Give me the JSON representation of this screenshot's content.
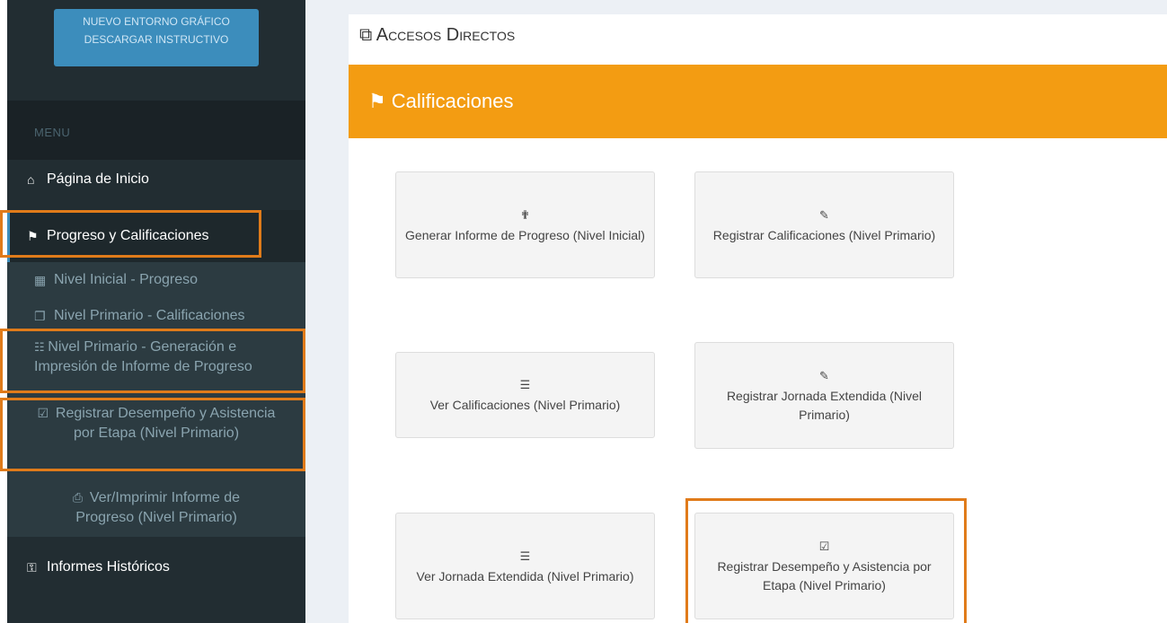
{
  "sidebar": {
    "banner": {
      "line1": "NUEVO ENTORNO GRÁFICO",
      "line2": "DESCARGAR INSTRUCTIVO"
    },
    "menu_header": "MENU",
    "home": "Página de Inicio",
    "progreso": "Progreso y Calificaciones",
    "sub": {
      "inicial": "Nivel Inicial - Progreso",
      "primario_calif": "Nivel Primario - Calificaciones",
      "generacion": "Nivel Primario - Generación e Impresión de Informe de Progreso",
      "registrar": "Registrar Desempeño y Asistencia por Etapa (Nivel Primario)",
      "imprimir": "Ver/Imprimir Informe de Progreso (Nivel Primario)"
    },
    "historicos": "Informes Históricos"
  },
  "content": {
    "title": "Accesos Directos",
    "section": "Calificaciones",
    "tiles": [
      {
        "icon": "child-icon",
        "label": "Generar Informe de Progreso (Nivel Inicial)"
      },
      {
        "icon": "edit-icon",
        "label": "Registrar Calificaciones (Nivel Primario)"
      },
      {
        "icon": "list-icon",
        "label": "Ver Calificaciones (Nivel Primario)"
      },
      {
        "icon": "edit-icon",
        "label": "Registrar Jornada Extendida (Nivel Primario)"
      },
      {
        "icon": "list-icon",
        "label": "Ver Jornada Extendida (Nivel Primario)"
      },
      {
        "icon": "check-square-icon",
        "label": "Registrar Desempeño y Asistencia por Etapa (Nivel Primario)"
      }
    ]
  },
  "colors": {
    "sidebar": "#222d32",
    "accent_orange": "#f39c12",
    "highlight": "#e07b1a",
    "banner_blue": "#3c8dbc"
  }
}
